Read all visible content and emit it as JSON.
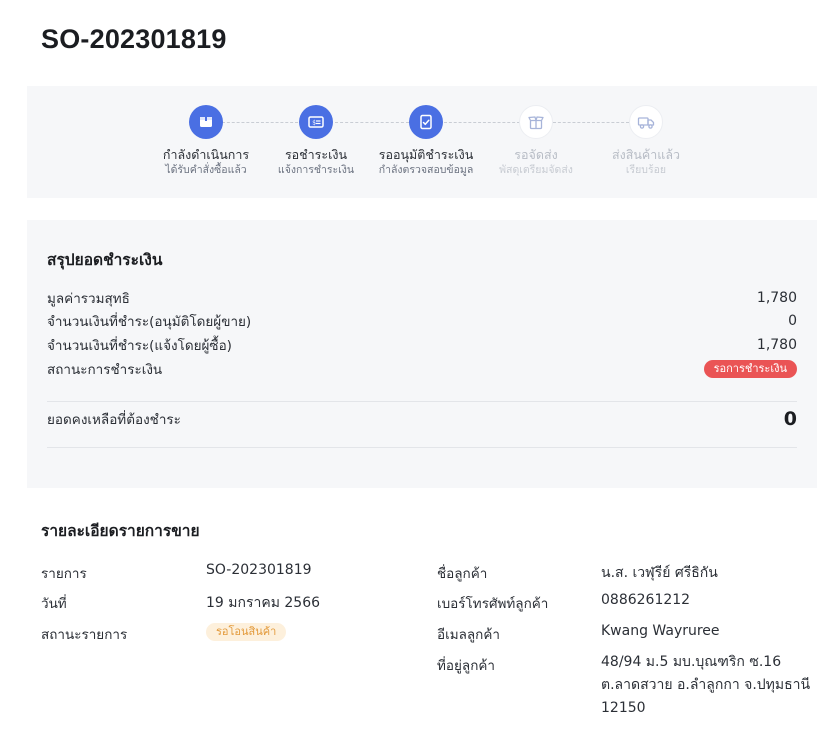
{
  "order": {
    "title": "SO-202301819"
  },
  "steps": [
    {
      "label": "กำลังดำเนินการ",
      "sub": "ได้รับคำสั่งซื้อแล้ว",
      "state": "active",
      "icon": "box-icon"
    },
    {
      "label": "รอชำระเงิน",
      "sub": "แจ้งการชำระเงิน",
      "state": "active",
      "icon": "payment-card-icon"
    },
    {
      "label": "รออนุมัติชำระเงิน",
      "sub": "กำลังตรวจสอบข้อมูล",
      "state": "active",
      "icon": "clipboard-check-icon"
    },
    {
      "label": "รอจัดส่ง",
      "sub": "พัสดุเตรียมจัดส่ง",
      "state": "inactive",
      "icon": "package-open-icon"
    },
    {
      "label": "ส่งสินค้าแล้ว",
      "sub": "เรียบร้อย",
      "state": "inactive",
      "icon": "truck-icon"
    }
  ],
  "summary": {
    "title": "สรุปยอดชำระเงิน",
    "rows": [
      {
        "label": "มูลค่ารวมสุทธิ",
        "value": "1,780"
      },
      {
        "label": "จำนวนเงินที่ชำระ(อนุมัติโดยผู้ขาย)",
        "value": "0"
      },
      {
        "label": "จำนวนเงินที่ชำระ(แจ้งโดยผู้ซื้อ)",
        "value": "1,780"
      }
    ],
    "payment_status_label": "สถานะการชำระเงิน",
    "payment_status_value": "รอการชำระเงิน",
    "balance_label": "ยอดคงเหลือที่ต้องชำระ",
    "balance_value": "0"
  },
  "details": {
    "title": "รายละเอียดรายการขาย",
    "item_label": "รายการ",
    "item_value": "SO-202301819",
    "date_label": "วันที่",
    "date_value": "19 มกราคม 2566",
    "status_label": "สถานะรายการ",
    "status_value": "รอโอนสินค้า",
    "customer_name_label": "ชื่อลูกค้า",
    "customer_name_value": "น.ส. เวฬุรีย์ ศรีธิกัน",
    "phone_label": "เบอร์โทรศัพท์ลูกค้า",
    "phone_value": "0886261212",
    "email_label": "อีเมลลูกค้า",
    "email_value": "Kwang Wayruree",
    "address_label": "ที่อยู่ลูกค้า",
    "address_lines": [
      "48/94 ม.5 มบ.บุณฑริก ซ.16",
      "ต.ลาดสวาย อ.ลำลูกกา จ.ปทุมธานี",
      "12150"
    ]
  },
  "colors": {
    "accent": "#4a6fe3",
    "payment_pill": "#ea5455",
    "status_pill_bg": "#fdf0dc",
    "status_pill_text": "#e39a3b"
  }
}
